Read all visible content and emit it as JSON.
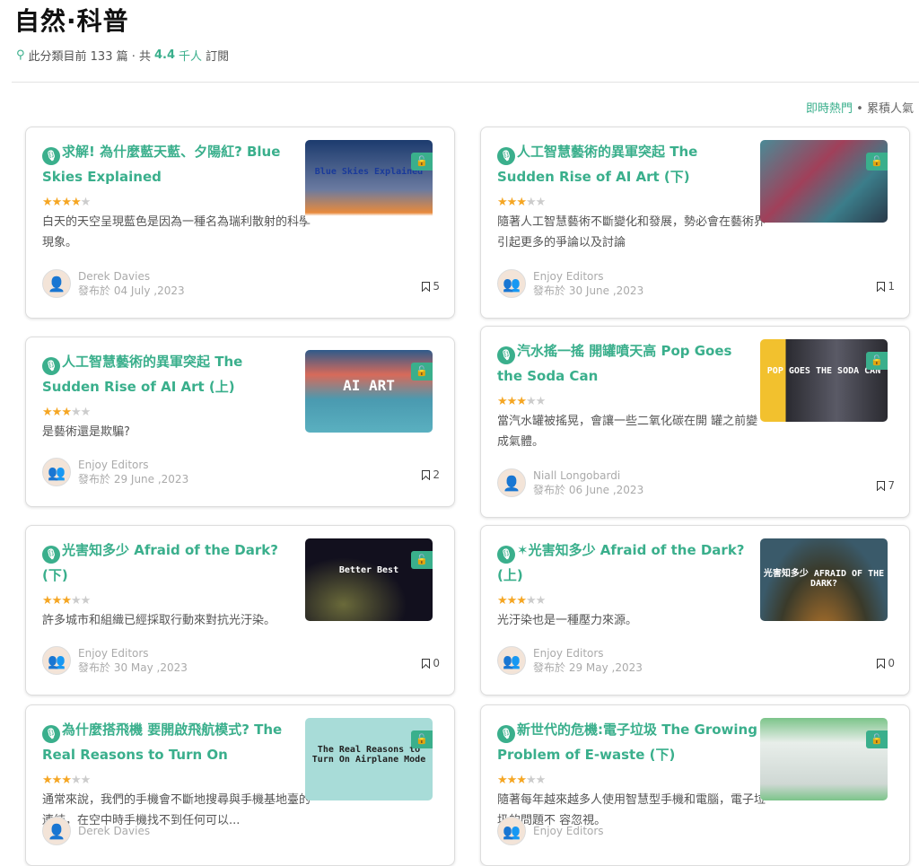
{
  "header": {
    "title": "自然·科普",
    "meta_prefix": "此分類目前 133 篇 · 共 ",
    "subscribers": "4.4",
    "meta_suffix": " 千人",
    "meta_end": "訂閱",
    "icon": "tree-icon"
  },
  "sort": {
    "active": "即時熱門",
    "separator": " • ",
    "other": "累積人氣"
  },
  "accent": "#3aaf8c",
  "cards": [
    {
      "title": "求解! 為什麼藍天藍、夕陽紅? Blue Skies Explained",
      "rating": 4,
      "desc": "白天的天空呈現藍色是因為一種名為瑞利散射的科學現象。",
      "author": "Derek Davies",
      "date": "發布於 04 July ,2023",
      "bookmarks": "5",
      "locked": true,
      "thumb_text": "Blue Skies Explained",
      "thumb_bg": "linear-gradient(180deg,#1c3b6e,#6a7aa0 60%,#e88a3c 88%,#fff 92%)"
    },
    {
      "title": "人工智慧藝術的異軍突起 The Sudden Rise of AI Art (下)",
      "rating": 3,
      "desc": "隨著人工智慧藝術不斷變化和發展，勢必會在藝術界引起更多的爭論以及討論",
      "author": "Enjoy Editors",
      "date": "發布於 30 June ,2023",
      "bookmarks": "1",
      "locked": true,
      "thumb_text": "",
      "thumb_bg": "linear-gradient(135deg,#4a8a96,#a0405a 40%,#3b7d8a 70%,#2a3a4a)"
    },
    {
      "title": "人工智慧藝術的異軍突起 The Sudden Rise of AI Art (上)",
      "rating": 3,
      "desc": "是藝術還是欺騙?",
      "author": "Enjoy Editors",
      "date": "發布於 29 June ,2023",
      "bookmarks": "2",
      "locked": true,
      "thumb_text": "AI ART",
      "thumb_bg": "linear-gradient(180deg,#2e5a8a,#d86a5a 30%,#4a9ab0 60%,#5ab0c0)"
    },
    {
      "title": "汽水搖一搖 開罐噴天高 Pop Goes the Soda Can",
      "rating": 3,
      "desc": "當汽水罐被搖晃，會讓一些二氧化碳在開 罐之前變成氣體。",
      "author": "Niall Longobardi",
      "date": "發布於 06 June ,2023",
      "bookmarks": "7",
      "locked": true,
      "thumb_text": "POP GOES THE SODA CAN",
      "thumb_bg": "linear-gradient(90deg,#f2c12e 0,#f2c12e 20%,#2a2a30 20%,#5a5a66 60%,#2a2a30)"
    },
    {
      "title": "光害知多少 Afraid of the Dark? (下)",
      "rating": 3,
      "desc": "許多城市和組織已經採取行動來對抗光汙染。",
      "author": "Enjoy Editors",
      "date": "發布於 30 May ,2023",
      "bookmarks": "0",
      "locked": true,
      "thumb_text": "Better   Best",
      "thumb_bg": "radial-gradient(ellipse at 30% 80%,#6a6a3a,#12101e 50%)"
    },
    {
      "title": "✶光害知多少 Afraid of the Dark? (上)",
      "rating": 3,
      "desc": "光汙染也是一種壓力來源。",
      "author": "Enjoy Editors",
      "date": "發布於 29 May ,2023",
      "bookmarks": "0",
      "locked": false,
      "thumb_text": "光害知多少 AFRAID OF THE DARK?",
      "thumb_bg": "radial-gradient(ellipse at 50% 130%,#c07a2a,#3a3a2a 50%,#3a5a6a 75%)"
    },
    {
      "title": "為什麼搭飛機 要開啟飛航模式? The Real Reasons to Turn On Airplane...",
      "rating": 3,
      "desc": "通常來說，我們的手機會不斷地搜尋與手機基地臺的連結，在空中時手機找不到任何可以...",
      "author": "Derek Davies",
      "date": "",
      "bookmarks": "",
      "locked": true,
      "thumb_text": "The Real Reasons to Turn On Airplane Mode",
      "thumb_bg": "#a8dcd8"
    },
    {
      "title": "新世代的危機:電子垃圾 The Growing Problem of E-waste (下)",
      "rating": 3,
      "desc": "隨著每年越來越多人使用智慧型手機和電腦，電子垃圾的問題不 容忽視。",
      "author": "Enjoy Editors",
      "date": "",
      "bookmarks": "",
      "locked": true,
      "thumb_text": "",
      "thumb_bg": "linear-gradient(180deg,#7cc48a,#e8eeea 30%,#cfd8d4 80%,#7cc48a)"
    }
  ]
}
